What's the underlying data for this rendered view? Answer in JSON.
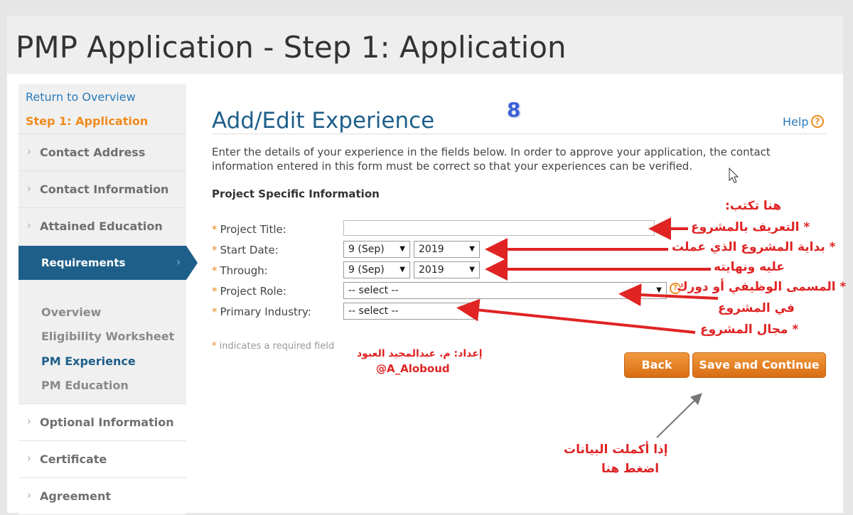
{
  "header": {
    "title": "PMP Application - Step 1: Application"
  },
  "sidebar": {
    "return_link": "Return to Overview",
    "current_step": "Step 1: Application",
    "items": [
      {
        "label": "Contact Address"
      },
      {
        "label": "Contact Information"
      },
      {
        "label": "Attained Education"
      }
    ],
    "active_item": {
      "label": "Requirements"
    },
    "sub_items": [
      {
        "label": "Overview"
      },
      {
        "label": "Eligibility Worksheet"
      },
      {
        "label": "PM Experience"
      },
      {
        "label": "PM Education"
      }
    ],
    "items_after": [
      {
        "label": "Optional Information"
      },
      {
        "label": "Certificate"
      },
      {
        "label": "Agreement"
      }
    ]
  },
  "main": {
    "title": "Add/Edit Experience",
    "help_label": "Help",
    "help_icon_glyph": "?",
    "intro": "Enter the details of your experience in the fields below. In order to approve your application, the contact information entered in this form must be correct so that your experiences can be verified.",
    "section_heading": "Project Specific Information",
    "required_marker": "*",
    "fields": {
      "project_title": {
        "label": "Project Title:",
        "value": ""
      },
      "start_date": {
        "label": "Start Date:",
        "month": "9 (Sep)",
        "year": "2019"
      },
      "through": {
        "label": "Through:",
        "month": "9 (Sep)",
        "year": "2019"
      },
      "project_role": {
        "label": "Project Role:",
        "value": "-- select --"
      },
      "primary_industry": {
        "label": "Primary Industry:",
        "value": "-- select --"
      }
    },
    "required_note": "indicates a required field",
    "buttons": {
      "back": "Back",
      "save_continue": "Save and Continue"
    }
  },
  "annotations": {
    "step_number": "8",
    "write_here": "هنا تكتب:",
    "project_definition": "* التعريف بالمشروع",
    "project_start": "* بداية المشروع الذي عملت",
    "project_end": "عليه ونهايته",
    "role_line1": "* المسمى الوظيفي أو دورك",
    "role_line2": "في المشروع",
    "industry": "* مجال المشروع",
    "credit_line1": "إعداد: م. عبدالمجيد العبود",
    "credit_line2": "@A_Aloboud",
    "done_line1": "إذا أكملت البيانات",
    "done_line2": "اضغط هنا"
  },
  "colors": {
    "accent_blue": "#1e5f8a",
    "link_blue": "#2a7ab8",
    "orange": "#f08a1c",
    "annotation_red": "#e02323"
  },
  "icons": [
    "chevron-right-icon",
    "help-icon",
    "dropdown-arrow-icon",
    "cursor-icon",
    "annotation-arrow-icon"
  ]
}
